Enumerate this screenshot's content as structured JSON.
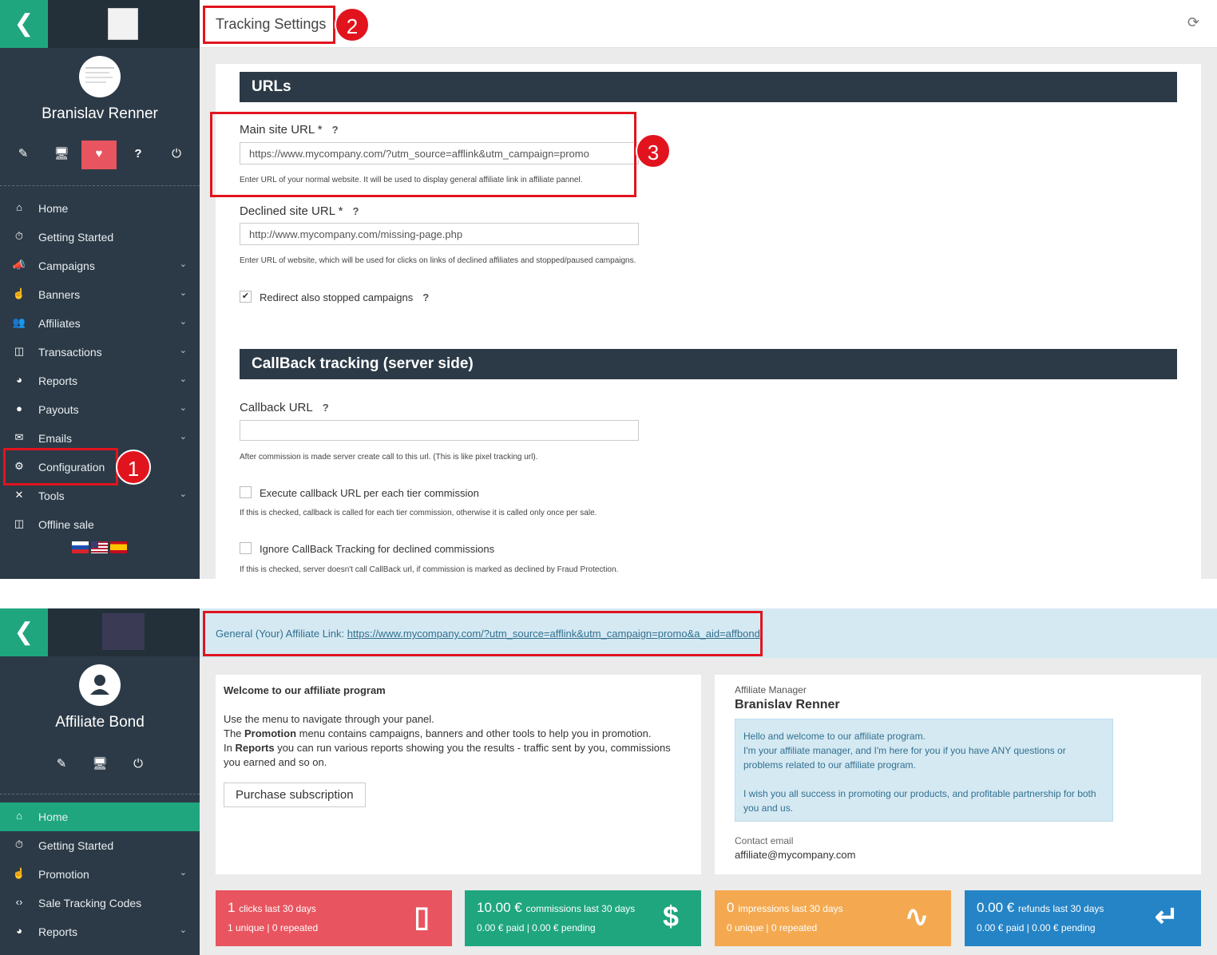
{
  "panel1": {
    "sidebar": {
      "user_name": "Branislav Renner",
      "nav": [
        {
          "label": "Home",
          "icon": "home-icon"
        },
        {
          "label": "Getting Started",
          "icon": "stopwatch-icon"
        },
        {
          "label": "Campaigns",
          "icon": "megaphone-icon"
        },
        {
          "label": "Banners",
          "icon": "pointer-hand-icon"
        },
        {
          "label": "Affiliates",
          "icon": "users-icon"
        },
        {
          "label": "Transactions",
          "icon": "basket-icon"
        },
        {
          "label": "Reports",
          "icon": "pie-chart-icon"
        },
        {
          "label": "Payouts",
          "icon": "money-bag-icon"
        },
        {
          "label": "Emails",
          "icon": "envelope-icon"
        },
        {
          "label": "Configuration",
          "icon": "gear-icon"
        },
        {
          "label": "Tools",
          "icon": "wrench-icon"
        },
        {
          "label": "Offline sale",
          "icon": "basket-icon"
        }
      ],
      "languages": [
        "sk-flag",
        "us-flag",
        "es-flag"
      ]
    },
    "header": {
      "title": "Tracking Settings"
    },
    "urls_section": {
      "title": "URLs",
      "main_url_label": "Main site URL *",
      "main_url_value": "https://www.mycompany.com/?utm_source=afflink&utm_campaign=promo",
      "main_url_help": "Enter URL of your normal website. It will be used to display general affiliate link in affiliate pannel.",
      "declined_url_label": "Declined site URL *",
      "declined_url_value": "http://www.mycompany.com/missing-page.php",
      "declined_url_help": "Enter URL of website, which will be used for clicks on links of declined affiliates and stopped/paused campaigns.",
      "redirect_label": "Redirect also stopped campaigns",
      "redirect_checked": true
    },
    "callback_section": {
      "title": "CallBack tracking (server side)",
      "callback_url_label": "Callback URL",
      "callback_url_value": "",
      "callback_url_help": "After commission is made server create call to this url. (This is like pixel tracking url).",
      "per_tier_label": "Execute callback URL per each tier commission",
      "per_tier_help": "If this is checked, callback is called for each tier commission, otherwise it is called only once per sale.",
      "ignore_declined_label": "Ignore CallBack Tracking for declined commissions",
      "ignore_declined_help": "If this is checked, server doesn't call CallBack url, if commission is marked as declined by Fraud Protection."
    },
    "badges": [
      "1",
      "2",
      "3"
    ],
    "q_mark": "?"
  },
  "panel2": {
    "sidebar": {
      "user_name": "Affiliate Bond",
      "nav": [
        {
          "label": "Home",
          "icon": "home-icon"
        },
        {
          "label": "Getting Started",
          "icon": "stopwatch-icon"
        },
        {
          "label": "Promotion",
          "icon": "pointer-hand-icon"
        },
        {
          "label": "Sale Tracking Codes",
          "icon": "code-icon"
        },
        {
          "label": "Reports",
          "icon": "pie-chart-icon"
        }
      ]
    },
    "affiliate_link": {
      "label": "General (Your) Affiliate Link:",
      "url": "https://www.mycompany.com/?utm_source=afflink&utm_campaign=promo&a_aid=affbond"
    },
    "welcome": {
      "title": "Welcome to our affiliate program",
      "line1": "Use the menu to navigate through your panel.",
      "line2_pre": "The ",
      "line2_bold": "Promotion",
      "line2_post": " menu contains campaigns, banners and other tools to help you in promotion.",
      "line3_pre": "In ",
      "line3_bold": "Reports",
      "line3_post": " you can run various reports showing you the results - traffic sent by you, commissions you earned and so on.",
      "button": "Purchase subscription"
    },
    "manager": {
      "label": "Affiliate Manager",
      "name": "Branislav Renner",
      "message_p1": "Hello and welcome to our affiliate program.",
      "message_p2": "I'm your affiliate manager, and I'm here for you if you have ANY questions or problems related to our affiliate program.",
      "message_p3": "I wish you all success in promoting our products, and profitable partnership for both you and us.",
      "contact_label": "Contact email",
      "contact_email": "affiliate@mycompany.com"
    },
    "stats": [
      {
        "value": "1",
        "label": "clicks last 30 days",
        "sub": "1 unique | 0 repeated",
        "color": "#e8545f",
        "icon": "mouse-icon"
      },
      {
        "value": "10.00 €",
        "label": "commissions last 30 days",
        "sub": "0.00 € paid | 0.00 € pending",
        "color": "#1fa67f",
        "icon": "dollar-icon"
      },
      {
        "value": "0",
        "label": "impressions last 30 days",
        "sub": "0 unique | 0 repeated",
        "color": "#f4a950",
        "icon": "trend-line-icon"
      },
      {
        "value": "0.00 €",
        "label": "refunds last 30 days",
        "sub": "0.00 € paid | 0.00 € pending",
        "color": "#2484c6",
        "icon": "return-arrow-icon"
      }
    ]
  }
}
